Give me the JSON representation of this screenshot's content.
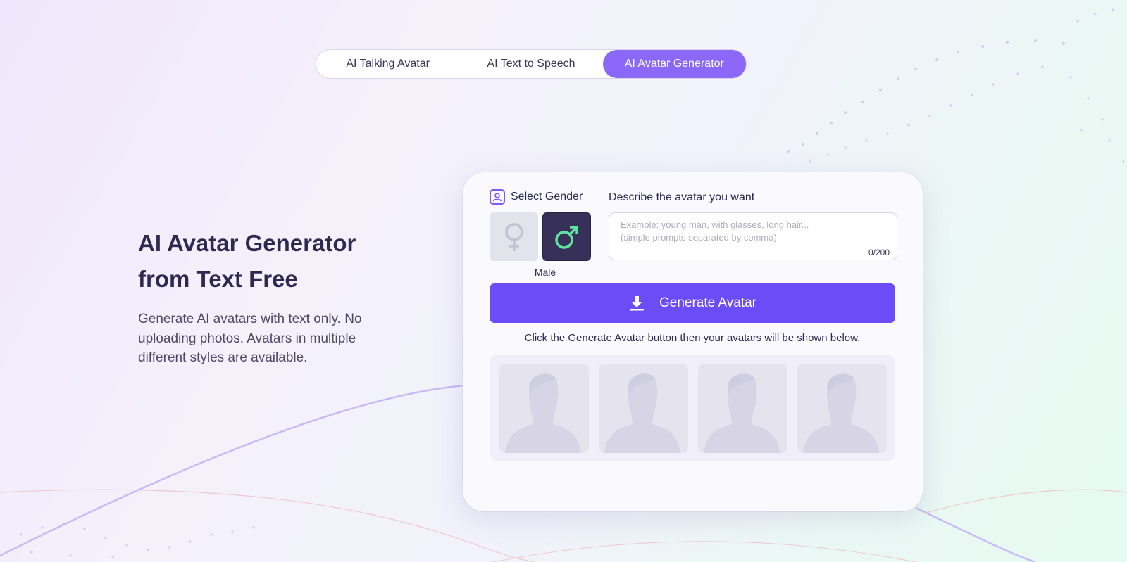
{
  "tabs": [
    {
      "label": "AI Talking Avatar"
    },
    {
      "label": "AI Text to Speech"
    },
    {
      "label": "AI Avatar Generator"
    }
  ],
  "hero": {
    "title_line1": "AI Avatar Generator",
    "title_line2": "from Text Free",
    "desc_line1": "Generate AI avatars with text only. No",
    "desc_line2": "uploading photos. Avatars in multiple",
    "desc_line3": "different styles are available."
  },
  "card": {
    "gender_label": "Select Gender",
    "selected_gender": "Male",
    "describe_label": "Describe the avatar you want",
    "prompt_placeholder": "Example: young man, with glasses, long hair...\n(simple prompts separated by comma)",
    "prompt_value": "",
    "counter": "0/200",
    "generate_label": "Generate Avatar",
    "hint": "Click the Generate Avatar button then your avatars will be shown below."
  },
  "colors": {
    "accent": "#6c4cf6",
    "tab_active": "#8b68f7",
    "male_symbol": "#5fe3a1"
  },
  "icons": [
    "user-icon",
    "female-icon",
    "male-icon",
    "download-icon",
    "avatar-silhouette-icon"
  ]
}
